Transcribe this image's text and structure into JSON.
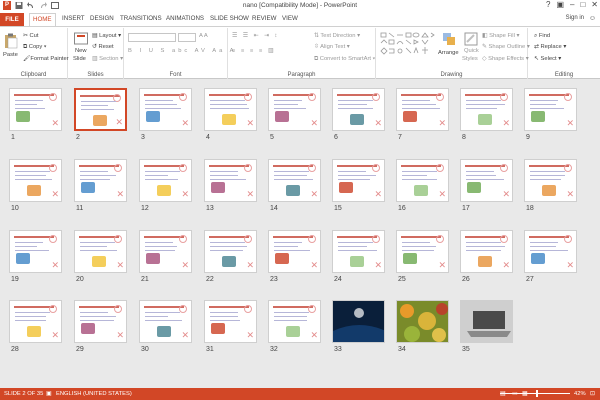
{
  "window": {
    "title": "nano [Compatibility Mode] - PowerPoint",
    "sign_in": "Sign in",
    "qat_logo": "P"
  },
  "tabs": [
    "FILE",
    "HOME",
    "INSERT",
    "DESIGN",
    "TRANSITIONS",
    "ANIMATIONS",
    "SLIDE SHOW",
    "REVIEW",
    "VIEW"
  ],
  "ribbon": {
    "clipboard": {
      "paste": "Paste",
      "cut": "Cut",
      "copy": "Copy",
      "format_painter": "Format Painter",
      "label": "Clipboard"
    },
    "slides": {
      "new_slide": "New",
      "new_slide2": "Slide",
      "layout": "Layout",
      "reset": "Reset",
      "section": "Section",
      "label": "Slides"
    },
    "font": {
      "label": "Font"
    },
    "paragraph": {
      "text_direction": "Text Direction",
      "align_text": "Align Text",
      "convert": "Convert to SmartArt",
      "label": "Paragraph"
    },
    "drawing": {
      "arrange": "Arrange",
      "quick_styles": "Quick",
      "quick_styles2": "Styles",
      "shape_fill": "Shape Fill",
      "shape_outline": "Shape Outline",
      "shape_effects": "Shape Effects",
      "label": "Drawing"
    },
    "editing": {
      "find": "Find",
      "replace": "Replace",
      "select": "Select",
      "label": "Editing"
    }
  },
  "slides": [
    {
      "n": "1"
    },
    {
      "n": "2",
      "selected": true
    },
    {
      "n": "3"
    },
    {
      "n": "4"
    },
    {
      "n": "5"
    },
    {
      "n": "6"
    },
    {
      "n": "7"
    },
    {
      "n": "8"
    },
    {
      "n": "9"
    },
    {
      "n": "10"
    },
    {
      "n": "11"
    },
    {
      "n": "12"
    },
    {
      "n": "13"
    },
    {
      "n": "14"
    },
    {
      "n": "15"
    },
    {
      "n": "16"
    },
    {
      "n": "17"
    },
    {
      "n": "18"
    },
    {
      "n": "19"
    },
    {
      "n": "20"
    },
    {
      "n": "21"
    },
    {
      "n": "22"
    },
    {
      "n": "23"
    },
    {
      "n": "24"
    },
    {
      "n": "25"
    },
    {
      "n": "26"
    },
    {
      "n": "27"
    },
    {
      "n": "28"
    },
    {
      "n": "29"
    },
    {
      "n": "30"
    },
    {
      "n": "31"
    },
    {
      "n": "32"
    },
    {
      "n": "33",
      "photo": "night"
    },
    {
      "n": "34",
      "photo": "leaves"
    },
    {
      "n": "35",
      "photo": "laptop"
    }
  ],
  "status": {
    "slide_counter": "SLIDE 2 OF 35",
    "language": "ENGLISH (UNITED STATES)",
    "zoom": "42%"
  },
  "colors": {
    "accent": "#d24726"
  }
}
